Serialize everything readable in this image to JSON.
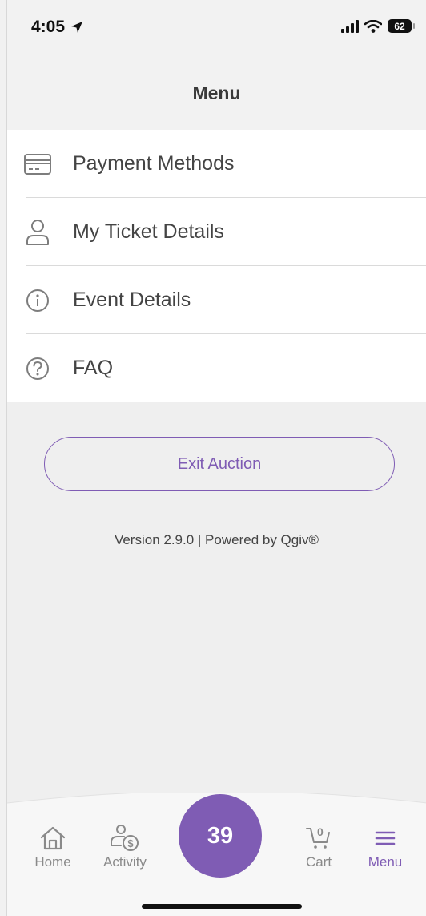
{
  "status_bar": {
    "time": "4:05",
    "battery": "62"
  },
  "header": {
    "title": "Menu"
  },
  "menu": {
    "items": [
      {
        "label": "Payment Methods",
        "icon": "credit-card-icon"
      },
      {
        "label": "My Ticket Details",
        "icon": "person-icon"
      },
      {
        "label": "Event Details",
        "icon": "info-icon"
      },
      {
        "label": "FAQ",
        "icon": "question-icon"
      }
    ]
  },
  "exit_button": {
    "label": "Exit Auction"
  },
  "footer": {
    "version": "Version 2.9.0 | Powered by Qgiv®"
  },
  "tabs": {
    "home": {
      "label": "Home",
      "icon": "home-icon"
    },
    "activity": {
      "label": "Activity",
      "icon": "activity-icon"
    },
    "center_badge": "39",
    "cart": {
      "label": "Cart",
      "count": "0",
      "icon": "cart-icon"
    },
    "menu": {
      "label": "Menu",
      "icon": "hamburger-icon"
    }
  },
  "colors": {
    "accent": "#7f5cb4",
    "background": "#efefef",
    "list_background": "#ffffff",
    "inactive_tab": "#8a8a8a"
  }
}
